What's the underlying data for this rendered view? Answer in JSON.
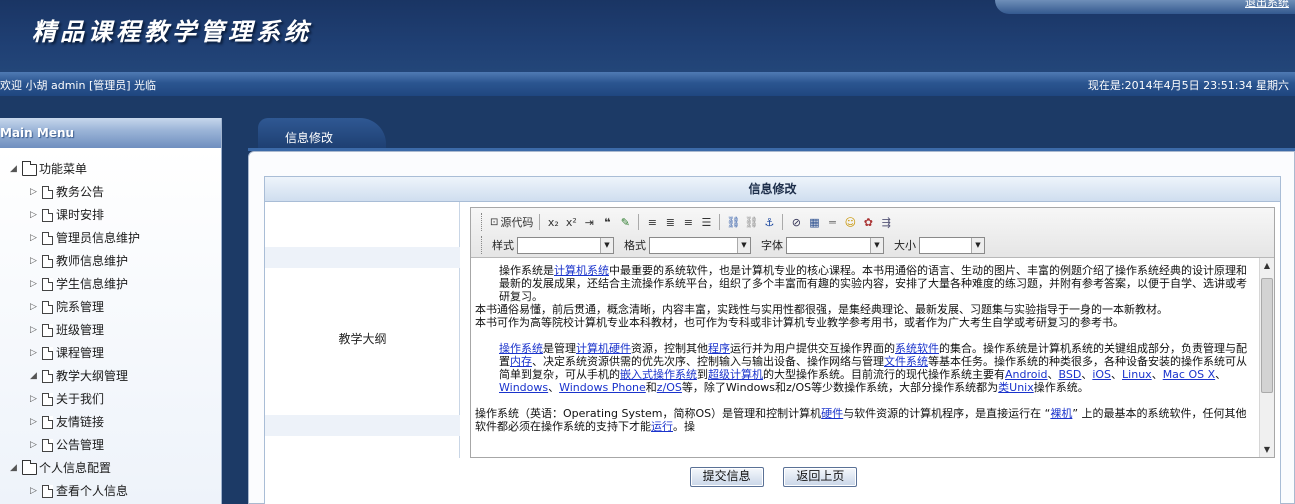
{
  "header": {
    "system_title": "精品课程教学管理系统",
    "logout_label": "退出系统"
  },
  "welcome_bar": {
    "welcome_text": "欢迎 小胡  admin [管理员] 光临",
    "clock_text": "现在是:2014年4月5日  23:51:34 星期六"
  },
  "sidebar": {
    "title": "Main Menu",
    "groups": [
      {
        "label": "功能菜单",
        "expanded": true,
        "items": [
          {
            "label": "教务公告",
            "expanded": false
          },
          {
            "label": "课时安排",
            "expanded": false
          },
          {
            "label": "管理员信息维护",
            "expanded": false
          },
          {
            "label": "教师信息维护",
            "expanded": false
          },
          {
            "label": "学生信息维护",
            "expanded": false
          },
          {
            "label": "院系管理",
            "expanded": false
          },
          {
            "label": "班级管理",
            "expanded": false
          },
          {
            "label": "课程管理",
            "expanded": false
          },
          {
            "label": "教学大纲管理",
            "expanded": true
          },
          {
            "label": "关于我们",
            "expanded": false
          },
          {
            "label": "友情链接",
            "expanded": false
          },
          {
            "label": "公告管理",
            "expanded": false
          }
        ]
      },
      {
        "label": "个人信息配置",
        "expanded": true,
        "items": [
          {
            "label": "查看个人信息",
            "expanded": false
          }
        ]
      }
    ]
  },
  "main": {
    "tab_label": "信息修改",
    "form_title": "信息修改",
    "field_label": "教学大纲",
    "editor": {
      "toolbar": {
        "source_label": "源代码",
        "style_label": "样式",
        "format_label": "格式",
        "font_label": "字体",
        "size_label": "大小",
        "style_value": "",
        "format_value": "",
        "font_value": "",
        "size_value": ""
      },
      "paragraph1": {
        "pre": "操作系统是",
        "link1": "计算机系统",
        "post": "中最重要的系统软件，也是计算机专业的核心课程。本书用通俗的语言、生动的图片、丰富的例题介绍了操作系统经典的设计原理和最新的发展成果，还结合主流操作系统平台，组织了多个丰富而有趣的实验内容，安排了大量各种难度的练习题，并附有参考答案，以便于自学、选讲或考研复习。"
      },
      "paragraph2": "本书通俗易懂，前后贯通，概念清晰，内容丰富，实践性与实用性都很强，是集经典理论、最新发展、习题集与实验指导于一身的一本新教材。",
      "paragraph3": "本书可作为高等院校计算机专业本科教材，也可作为专科或非计算机专业教学参考用书，或者作为广大考生自学或考研复习的参考书。",
      "paragraph4": {
        "link_os": "操作系统",
        "t1": "是管理",
        "link_hw": "计算机硬件",
        "t2": "资源，控制其他",
        "link_prog": "程序",
        "t3": "运行并为用户提供交互操作界面的",
        "link_sys": "系统软件",
        "t4": "的集合。操作系统是计算机系统的关键组成部分，负责管理与配置",
        "link_mem": "内存",
        "t5": "、决定系统资源供需的优先次序、控制输入与输出设备、操作网络与管理",
        "link_fs": "文件系统",
        "t6": "等基本任务。操作系统的种类很多，各种设备安装的操作系统可从简单到复杂，可从手机的",
        "link_embedded": "嵌入式操作系统",
        "t7": "到",
        "link_super": "超级计算机",
        "t8": "的大型操作系统。目前流行的现代操作系统主要有",
        "link_android": "Android",
        "s1": "、",
        "link_bsd": "BSD",
        "s2": "、",
        "link_ios": "iOS",
        "s3": "、",
        "link_linux": "Linux",
        "s4": "、",
        "link_macosx": "Mac OS X",
        "s5": "、",
        "link_windows": "Windows",
        "s6": "、",
        "link_wp": "Windows Phone",
        "t9": "和",
        "link_zos": "z/OS",
        "t10": "等，除了Windows和z/OS等少数操作系统，大部分操作系统都为",
        "link_unix": "类Unix",
        "t11": "操作系统。"
      },
      "paragraph5": {
        "t1": "操作系统（英语：Operating System，简称OS）是管理和控制计算机",
        "link_hw": "硬件",
        "t2": "与软件资源的计算机程序，是直接运行在 “",
        "link_bare": "裸机",
        "t3": "” 上的最基本的系统软件，任何其他软件都必须在操作系统的支持下才能",
        "link_run": "运行",
        "t4": "。操"
      }
    },
    "submit_label": "提交信息",
    "back_label": "返回上页"
  }
}
